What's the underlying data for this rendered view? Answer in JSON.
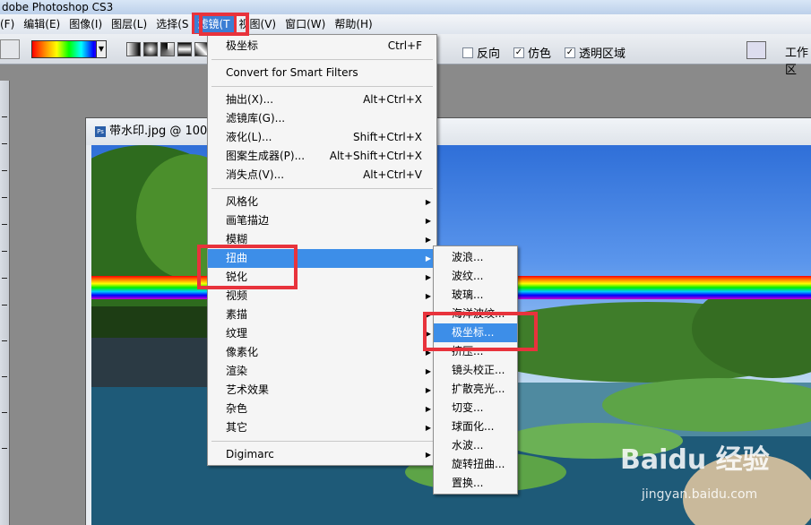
{
  "app": {
    "title": "dobe Photoshop CS3"
  },
  "menubar": [
    "(F)",
    "编辑(E)",
    "图像(I)",
    "图层(L)",
    "选择(S",
    "滤镜(T",
    "视图(V)",
    "窗口(W)",
    "帮助(H)"
  ],
  "options": {
    "reverse": "反向",
    "dither": "仿色",
    "transparency": "透明区域",
    "workspace": "工作区"
  },
  "document": {
    "title": "带水印.jpg @ 100%"
  },
  "filter_menu": {
    "items": [
      {
        "label": "极坐标",
        "shortcut": "Ctrl+F"
      },
      {
        "label": "Convert for Smart Filters",
        "shortcut": ""
      },
      {
        "label": "抽出(X)...",
        "shortcut": "Alt+Ctrl+X"
      },
      {
        "label": "滤镜库(G)...",
        "shortcut": ""
      },
      {
        "label": "液化(L)...",
        "shortcut": "Shift+Ctrl+X"
      },
      {
        "label": "图案生成器(P)...",
        "shortcut": "Alt+Shift+Ctrl+X"
      },
      {
        "label": "消失点(V)...",
        "shortcut": "Alt+Ctrl+V"
      },
      {
        "label": "风格化",
        "shortcut": ""
      },
      {
        "label": "画笔描边",
        "shortcut": ""
      },
      {
        "label": "模糊",
        "shortcut": ""
      },
      {
        "label": "扭曲",
        "shortcut": ""
      },
      {
        "label": "锐化",
        "shortcut": ""
      },
      {
        "label": "视频",
        "shortcut": ""
      },
      {
        "label": "素描",
        "shortcut": ""
      },
      {
        "label": "纹理",
        "shortcut": ""
      },
      {
        "label": "像素化",
        "shortcut": ""
      },
      {
        "label": "渲染",
        "shortcut": ""
      },
      {
        "label": "艺术效果",
        "shortcut": ""
      },
      {
        "label": "杂色",
        "shortcut": ""
      },
      {
        "label": "其它",
        "shortcut": ""
      },
      {
        "label": "Digimarc",
        "shortcut": ""
      }
    ]
  },
  "distort_submenu": {
    "items": [
      "波浪...",
      "波纹...",
      "玻璃...",
      "海洋波纹...",
      "极坐标...",
      "挤压...",
      "镜头校正...",
      "扩散亮光...",
      "切变...",
      "球面化...",
      "水波...",
      "旋转扭曲...",
      "置换..."
    ]
  },
  "watermark": {
    "brand": "Baidu 经验",
    "url": "jingyan.baidu.com"
  },
  "colors": {
    "highlight": "#3d8ee8",
    "annotation": "#e8333c"
  }
}
